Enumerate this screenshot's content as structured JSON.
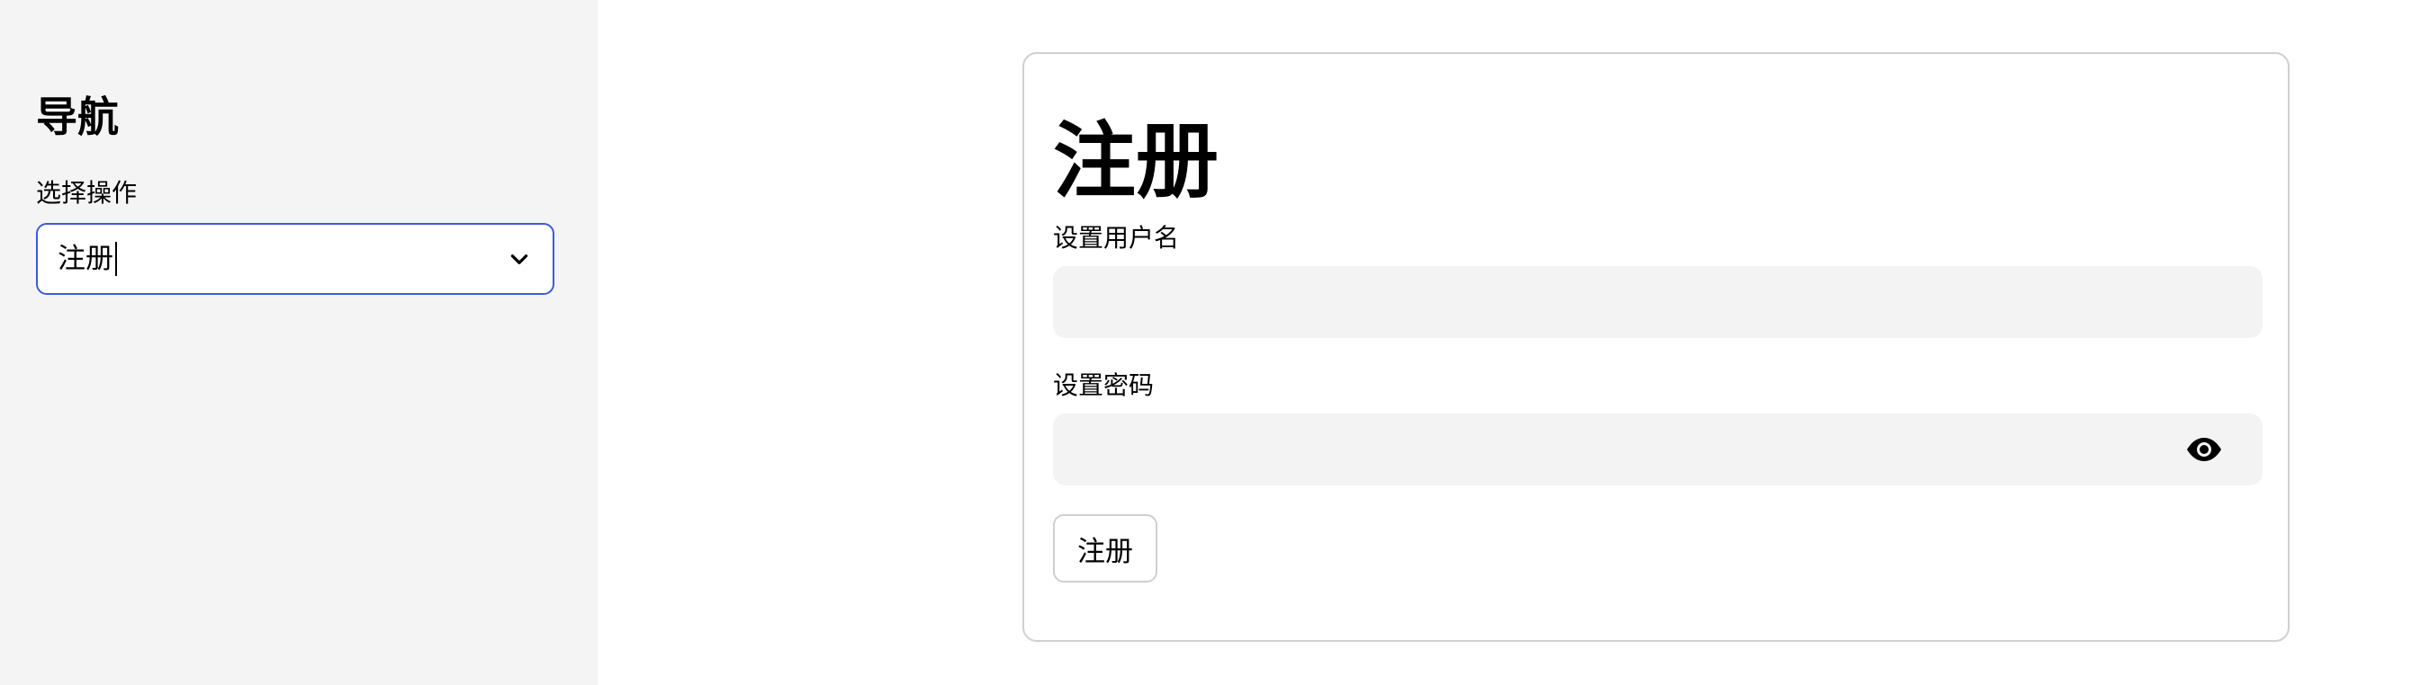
{
  "sidebar": {
    "title": "导航",
    "select_label": "选择操作",
    "select_value": "注册",
    "accent_color": "#3b5bdb"
  },
  "main": {
    "title": "注册",
    "username_label": "设置用户名",
    "username_value": "",
    "password_label": "设置密码",
    "password_value": "",
    "submit_label": "注册"
  },
  "icons": {
    "select_chevron": "chevron-down-icon",
    "password_toggle": "eye-icon"
  }
}
